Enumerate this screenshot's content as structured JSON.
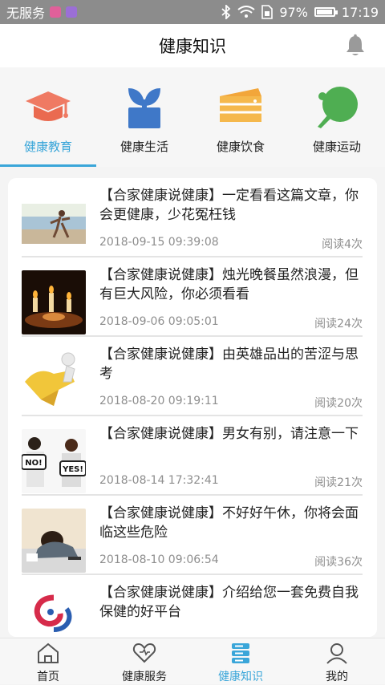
{
  "status_bar": {
    "carrier": "无服务",
    "battery": "97%",
    "battery_fraction": 0.97,
    "time": "17:19"
  },
  "header": {
    "title": "健康知识"
  },
  "categories": [
    {
      "label": "健康教育",
      "icon": "graduation-cap-icon",
      "active": true
    },
    {
      "label": "健康生活",
      "icon": "plant-pot-icon",
      "active": false
    },
    {
      "label": "健康饮食",
      "icon": "cake-icon",
      "active": false
    },
    {
      "label": "健康运动",
      "icon": "ping-pong-paddle-icon",
      "active": false
    }
  ],
  "articles": [
    {
      "title": "【合家健康说健康】一定看看这篇文章，你会更健康，少花冤枉钱",
      "date": "2018-09-15 09:39:08",
      "reads": "阅读4次"
    },
    {
      "title": "【合家健康说健康】烛光晚餐虽然浪漫，但有巨大风险，你必须看看",
      "date": "2018-09-06 09:05:01",
      "reads": "阅读24次"
    },
    {
      "title": "【合家健康说健康】由英雄品出的苦涩与思考",
      "date": "2018-08-20 09:19:11",
      "reads": "阅读20次"
    },
    {
      "title": "【合家健康说健康】男女有别，请注意一下",
      "date": "2018-08-14 17:32:41",
      "reads": "阅读21次",
      "thumb_text": [
        "NO!",
        "YES!"
      ]
    },
    {
      "title": "【合家健康说健康】不好好午休，你将会面临这些危险",
      "date": "2018-08-10 09:06:54",
      "reads": "阅读36次"
    },
    {
      "title": "【合家健康说健康】介绍给您一套免费自我保健的好平台",
      "date": "",
      "reads": ""
    }
  ],
  "tabs": [
    {
      "label": "首页",
      "icon": "home-icon",
      "active": false
    },
    {
      "label": "健康服务",
      "icon": "heart-icon",
      "active": false
    },
    {
      "label": "健康知识",
      "icon": "knowledge-icon",
      "active": true
    },
    {
      "label": "我的",
      "icon": "user-icon",
      "active": false
    }
  ],
  "colors": {
    "accent": "#3aa6d9",
    "status_bar": "#8c8c8c"
  }
}
